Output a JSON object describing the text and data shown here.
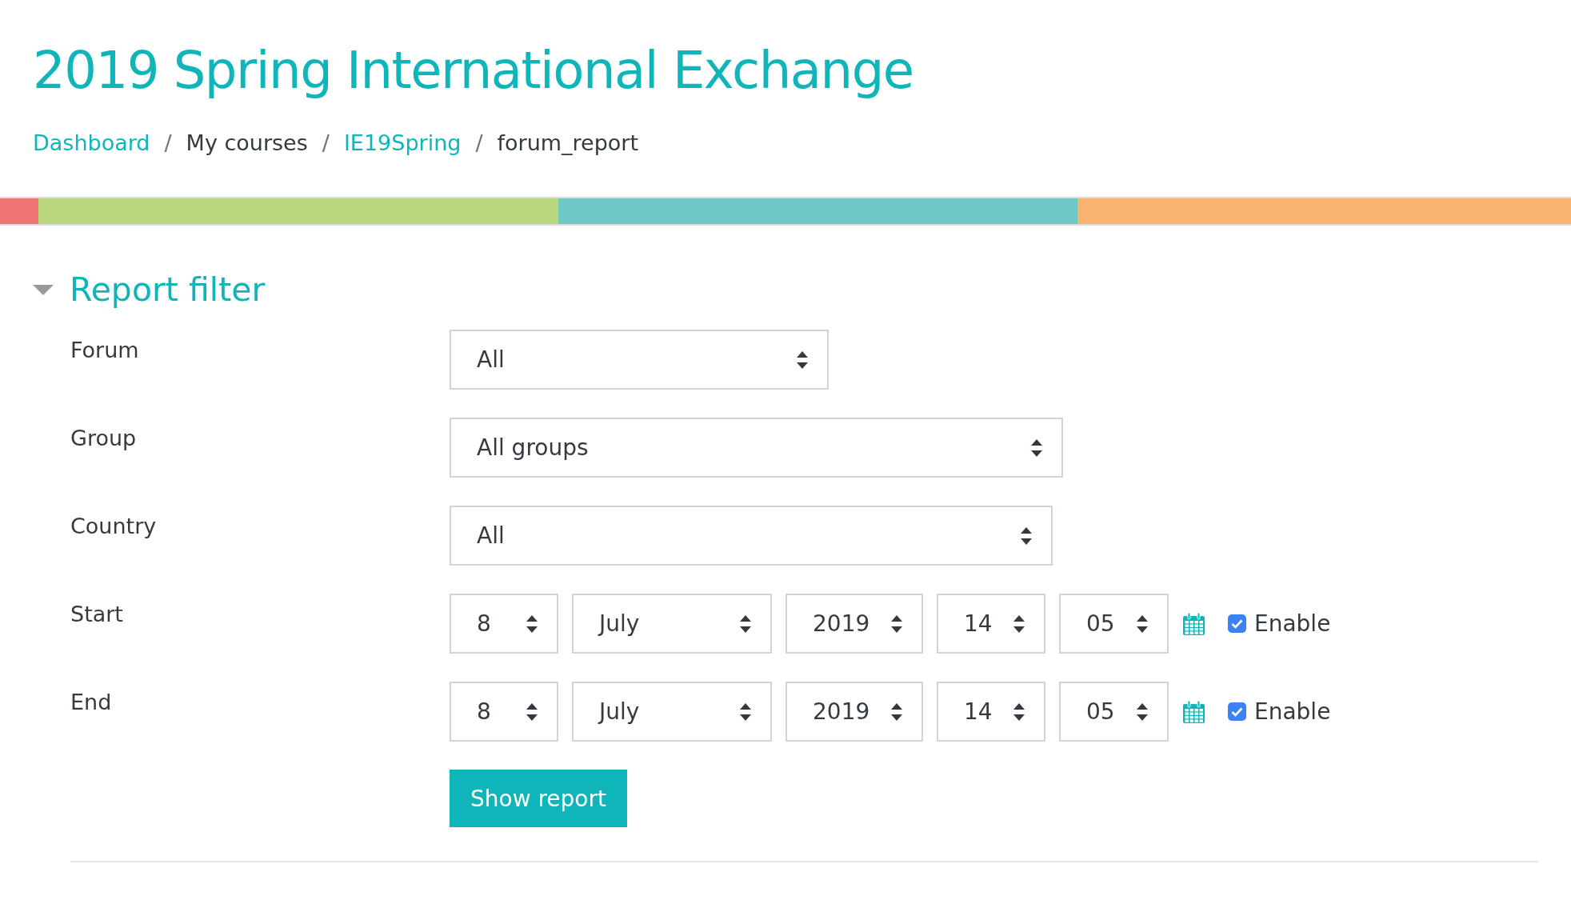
{
  "title": "2019 Spring International Exchange",
  "breadcrumb": [
    {
      "label": "Dashboard",
      "kind": "link"
    },
    {
      "separator": "/",
      "label": "My courses",
      "kind": "text"
    },
    {
      "separator": "/",
      "label": "IE19Spring",
      "kind": "link"
    },
    {
      "separator": "/",
      "label": "forum_report",
      "kind": "text"
    }
  ],
  "color_bar": [
    {
      "color": "#ee7373"
    },
    {
      "color": "#b8d77b"
    },
    {
      "color": "#6dc8c6"
    },
    {
      "color": "#f9b36f"
    }
  ],
  "section": {
    "title": "Report filter",
    "expanded": true
  },
  "fields": [
    {
      "kind": "select",
      "label": "Forum",
      "value": "All"
    },
    {
      "kind": "select",
      "label": "Group",
      "value": "All groups"
    },
    {
      "kind": "select",
      "label": "Country",
      "value": "All"
    },
    {
      "kind": "date",
      "label": "Start",
      "parts": [
        "8",
        "July",
        "2019",
        "14",
        "05"
      ],
      "enable_label": "Enable",
      "checked": true
    },
    {
      "kind": "date",
      "label": "End",
      "parts": [
        "8",
        "July",
        "2019",
        "14",
        "05"
      ],
      "enable_label": "Enable",
      "checked": true
    }
  ],
  "submit": "Show report"
}
